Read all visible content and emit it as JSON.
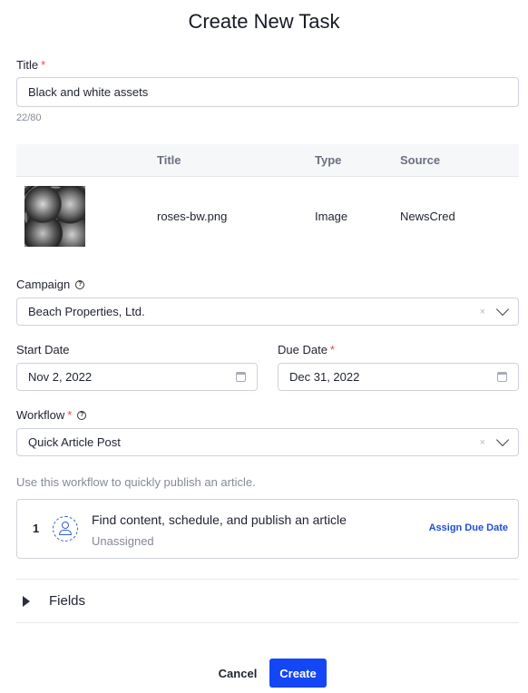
{
  "modal": {
    "title": "Create New Task"
  },
  "title_field": {
    "label": "Title",
    "value": "Black and white assets",
    "counter": "22/80"
  },
  "assets_table": {
    "columns": [
      "Title",
      "Type",
      "Source"
    ],
    "rows": [
      {
        "thumbnail": "roses-image",
        "title": "roses-bw.png",
        "type": "Image",
        "source": "NewsCred"
      }
    ]
  },
  "campaign": {
    "label": "Campaign",
    "value": "Beach Properties, Ltd.",
    "clear": "×"
  },
  "start_date": {
    "label": "Start Date",
    "value": "Nov 2, 2022"
  },
  "due_date": {
    "label": "Due Date",
    "value": "Dec 31, 2022"
  },
  "workflow": {
    "label": "Workflow",
    "value": "Quick Article Post",
    "clear": "×",
    "description": "Use this workflow to quickly publish an article.",
    "steps": [
      {
        "number": "1",
        "title": "Find content, schedule, and publish an article",
        "assignee": "Unassigned",
        "action": "Assign Due Date"
      }
    ]
  },
  "fields_section": {
    "label": "Fields"
  },
  "footer": {
    "cancel_label": "Cancel",
    "create_label": "Create"
  },
  "colors": {
    "primary": "#1346f5",
    "link": "#1f4fd6",
    "required": "#e5484d"
  },
  "icons": {
    "help": "help-circle-icon",
    "calendar": "calendar-icon",
    "chevron": "chevron-down-icon",
    "expand": "caret-right-icon",
    "assignee": "user-dashed-icon"
  }
}
